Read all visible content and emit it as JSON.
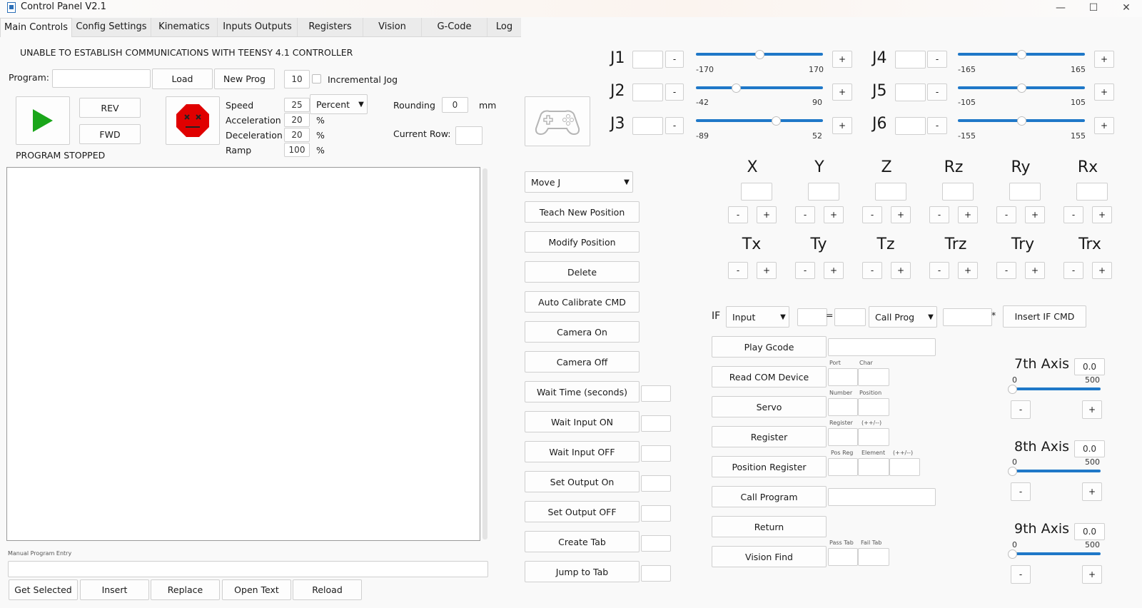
{
  "window": {
    "title": "Control Panel V2.1",
    "minimize": "—",
    "maximize": "☐",
    "close": "✕"
  },
  "tabs": [
    "Main Controls",
    "Config Settings",
    "Kinematics",
    "Inputs Outputs",
    "Registers",
    "Vision",
    "G-Code",
    "Log"
  ],
  "status": {
    "comms": "UNABLE TO ESTABLISH COMMUNICATIONS WITH TEENSY 4.1 CONTROLLER",
    "program_state": "PROGRAM STOPPED"
  },
  "program": {
    "label": "Program:",
    "value": "",
    "load": "Load",
    "new_prog": "New Prog",
    "jog_increment": "10",
    "incremental_jog": "Incremental Jog"
  },
  "run": {
    "rev": "REV",
    "fwd": "FWD"
  },
  "motion": {
    "speed_label": "Speed",
    "speed": "25",
    "speed_unit": "Percent",
    "accel_label": "Acceleration",
    "accel": "20",
    "decel_label": "Deceleration",
    "decel": "20",
    "ramp_label": "Ramp",
    "ramp": "100",
    "pct": "%",
    "rounding_label": "Rounding",
    "rounding": "0",
    "rounding_unit": "mm",
    "current_row_label": "Current Row:",
    "current_row": ""
  },
  "manual": {
    "label": "Manual Program Entry",
    "get_selected": "Get Selected",
    "insert": "Insert",
    "replace": "Replace",
    "open_text": "Open Text",
    "reload": "Reload"
  },
  "commands": {
    "move_type": "Move J",
    "teach": "Teach New Position",
    "modify": "Modify Position",
    "delete": "Delete",
    "auto_cal": "Auto Calibrate CMD",
    "camera_on": "Camera On",
    "camera_off": "Camera Off",
    "wait_time": "Wait Time (seconds)",
    "wait_on": "Wait Input ON",
    "wait_off": "Wait Input OFF",
    "set_on": "Set Output On",
    "set_off": "Set Output OFF",
    "create_tab": "Create Tab",
    "jump_tab": "Jump to Tab"
  },
  "joints": [
    {
      "name": "J1",
      "min": "-170",
      "max": "170",
      "pos": 0.5
    },
    {
      "name": "J2",
      "min": "-42",
      "max": "90",
      "pos": 0.32
    },
    {
      "name": "J3",
      "min": "-89",
      "max": "52",
      "pos": 0.63
    },
    {
      "name": "J4",
      "min": "-165",
      "max": "165",
      "pos": 0.5
    },
    {
      "name": "J5",
      "min": "-105",
      "max": "105",
      "pos": 0.5
    },
    {
      "name": "J6",
      "min": "-155",
      "max": "155",
      "pos": 0.5
    }
  ],
  "cart_axes": [
    "X",
    "Y",
    "Z",
    "Rz",
    "Ry",
    "Rx"
  ],
  "tool_axes": [
    "Tx",
    "Ty",
    "Tz",
    "Trz",
    "Try",
    "Trx"
  ],
  "jog": {
    "minus": "-",
    "plus": "+"
  },
  "if_cmd": {
    "label": "IF",
    "source": "Input",
    "eq": "=",
    "action": "Call Prog",
    "star": "*",
    "insert": "Insert IF CMD"
  },
  "right_cmds": {
    "play_gcode": "Play Gcode",
    "read_com": "Read COM Device",
    "servo": "Servo",
    "register": "Register",
    "position_register": "Position Register",
    "call_program": "Call Program",
    "return": "Return",
    "vision_find": "Vision Find",
    "port": "Port",
    "char": "Char",
    "number": "Number",
    "position": "Position",
    "reg": "Register",
    "incdec": "(++/--)",
    "pos_reg": "Pos Reg",
    "element": "Element",
    "pass_tab": "Pass Tab",
    "fail_tab": "Fail Tab"
  },
  "ext_axes": [
    {
      "name": "7th Axis",
      "value": "0.0",
      "min": "0",
      "max": "500",
      "pos": 0.0
    },
    {
      "name": "8th Axis",
      "value": "0.0",
      "min": "0",
      "max": "500",
      "pos": 0.0
    },
    {
      "name": "9th Axis",
      "value": "0.0",
      "min": "0",
      "max": "500",
      "pos": 0.0
    }
  ],
  "colors": {
    "accent": "#1f78c8",
    "play": "#1aa61a",
    "stop": "#e00000"
  }
}
